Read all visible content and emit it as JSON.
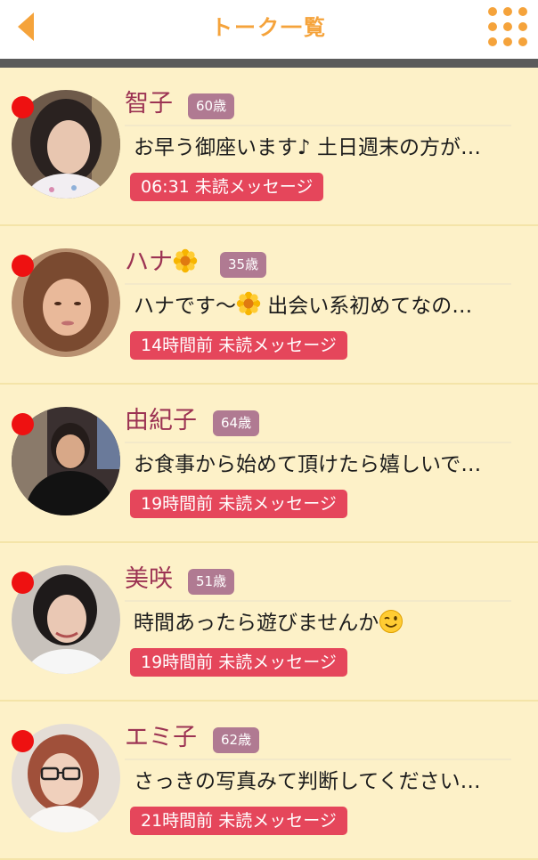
{
  "header": {
    "title": "トーク一覧",
    "back_icon": "chevron-left-icon",
    "menu_icon": "grid-menu-icon",
    "accent_color": "#f5a33b"
  },
  "unread_dot_color": "#ee1111",
  "badge_color": "#e5465b",
  "age_tag_color": "#b07a92",
  "items": [
    {
      "name": "智子",
      "age": "60歳",
      "message": "お早う御座います♪ 土日週末の方が…",
      "badge": "06:31 未読メッセージ"
    },
    {
      "name": "ハナ",
      "name_emoji": "flower-emoji",
      "age": "35歳",
      "message_prefix": "ハナです〜",
      "message_emoji": "flower-emoji",
      "message": " 出会い系初めてなの…",
      "badge": "14時間前 未読メッセージ"
    },
    {
      "name": "由紀子",
      "age": "64歳",
      "message": "お食事から始めて頂けたら嬉しいで…",
      "badge": "19時間前 未読メッセージ"
    },
    {
      "name": "美咲",
      "age": "51歳",
      "message": "時間あったら遊びませんか",
      "message_emoji": "wink-emoji",
      "badge": "19時間前 未読メッセージ"
    },
    {
      "name": "エミ子",
      "age": "62歳",
      "message": "さっきの写真みて判断してください…",
      "badge": "21時間前 未読メッセージ"
    }
  ]
}
